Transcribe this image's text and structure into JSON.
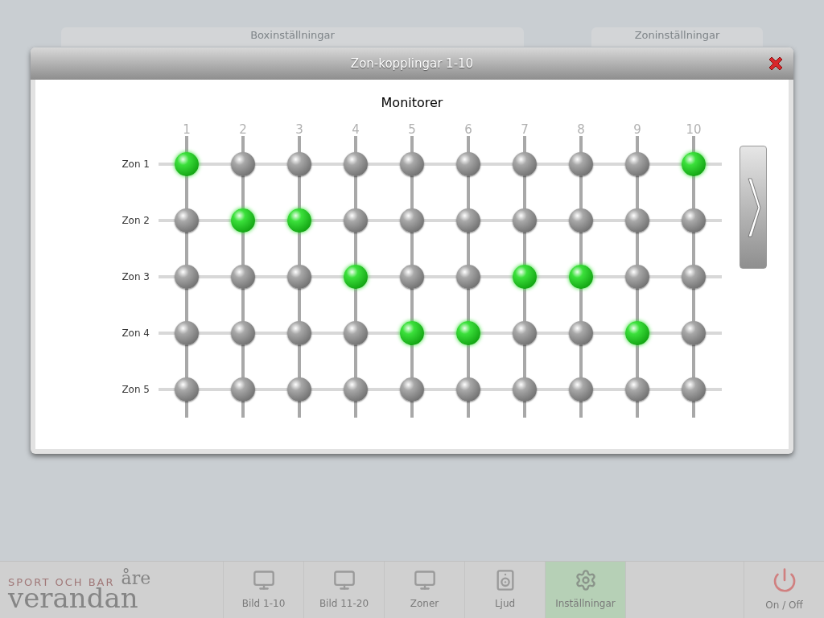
{
  "background_buttons": [
    "Boxinställningar",
    "Zoninställningar"
  ],
  "dialog": {
    "title": "Zon-kopplingar 1-10",
    "heading": "Monitorer",
    "columns": [
      "1",
      "2",
      "3",
      "4",
      "5",
      "6",
      "7",
      "8",
      "9",
      "10"
    ],
    "zones": [
      {
        "label": "Zon 1",
        "links": [
          {
            "on": true
          },
          {
            "on": false
          },
          {
            "on": false
          },
          {
            "on": false
          },
          {
            "on": false
          },
          {
            "on": false
          },
          {
            "on": false
          },
          {
            "on": false
          },
          {
            "on": false
          },
          {
            "on": true
          }
        ]
      },
      {
        "label": "Zon 2",
        "links": [
          {
            "on": false
          },
          {
            "on": true
          },
          {
            "on": true
          },
          {
            "on": false
          },
          {
            "on": false
          },
          {
            "on": false
          },
          {
            "on": false
          },
          {
            "on": false
          },
          {
            "on": false
          },
          {
            "on": false
          }
        ]
      },
      {
        "label": "Zon 3",
        "links": [
          {
            "on": false
          },
          {
            "on": false
          },
          {
            "on": false
          },
          {
            "on": true
          },
          {
            "on": false
          },
          {
            "on": false
          },
          {
            "on": true
          },
          {
            "on": true
          },
          {
            "on": false
          },
          {
            "on": false
          }
        ]
      },
      {
        "label": "Zon 4",
        "links": [
          {
            "on": false
          },
          {
            "on": false
          },
          {
            "on": false
          },
          {
            "on": false
          },
          {
            "on": true
          },
          {
            "on": true
          },
          {
            "on": false
          },
          {
            "on": false
          },
          {
            "on": true
          },
          {
            "on": false
          }
        ]
      },
      {
        "label": "Zon 5",
        "links": [
          {
            "on": false
          },
          {
            "on": false
          },
          {
            "on": false
          },
          {
            "on": false
          },
          {
            "on": false
          },
          {
            "on": false
          },
          {
            "on": false
          },
          {
            "on": false
          },
          {
            "on": false
          },
          {
            "on": false
          }
        ]
      }
    ]
  },
  "logo": {
    "tagline": "SPORT OCH BAR",
    "place": "åre",
    "name": "verandan"
  },
  "nav": [
    {
      "kind": "monitor",
      "label": "Bild 1-10",
      "selected": false
    },
    {
      "kind": "monitor",
      "label": "Bild 11-20",
      "selected": false
    },
    {
      "kind": "monitor",
      "label": "Zoner",
      "selected": false
    },
    {
      "kind": "speaker",
      "label": "Ljud",
      "selected": false
    },
    {
      "kind": "gears",
      "label": "Inställningar",
      "selected": true
    },
    {
      "kind": "empty",
      "selected": false
    },
    {
      "kind": "power",
      "label": "On / Off",
      "selected": false
    }
  ]
}
